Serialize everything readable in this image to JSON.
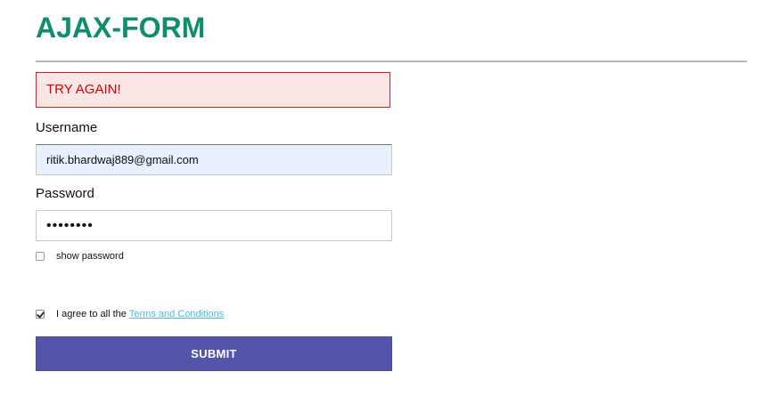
{
  "form": {
    "title": "AJAX-FORM",
    "alert_text": "TRY AGAIN!",
    "username": {
      "label": "Username",
      "value": "ritik.bhardwaj889@gmail.com"
    },
    "password": {
      "label": "Password",
      "value": "password"
    },
    "show_password": {
      "label": "show password",
      "checked": false
    },
    "agree": {
      "text": "I agree to all the",
      "link_text": "Terms and Conditions",
      "checked": true
    },
    "submit_label": "SUBMIT"
  },
  "colors": {
    "title": "#108c6e",
    "alert_border": "#d81e1e",
    "alert_background": "#fde6e6",
    "alert_text": "#d40000",
    "username_background": "#e8effd",
    "link": "#4fb7d6",
    "submit_background": "#5454aa"
  },
  "icons": {
    "show_password_checkbox": "checkbox-unchecked-icon",
    "agree_checkbox": "checkbox-checked-icon"
  }
}
